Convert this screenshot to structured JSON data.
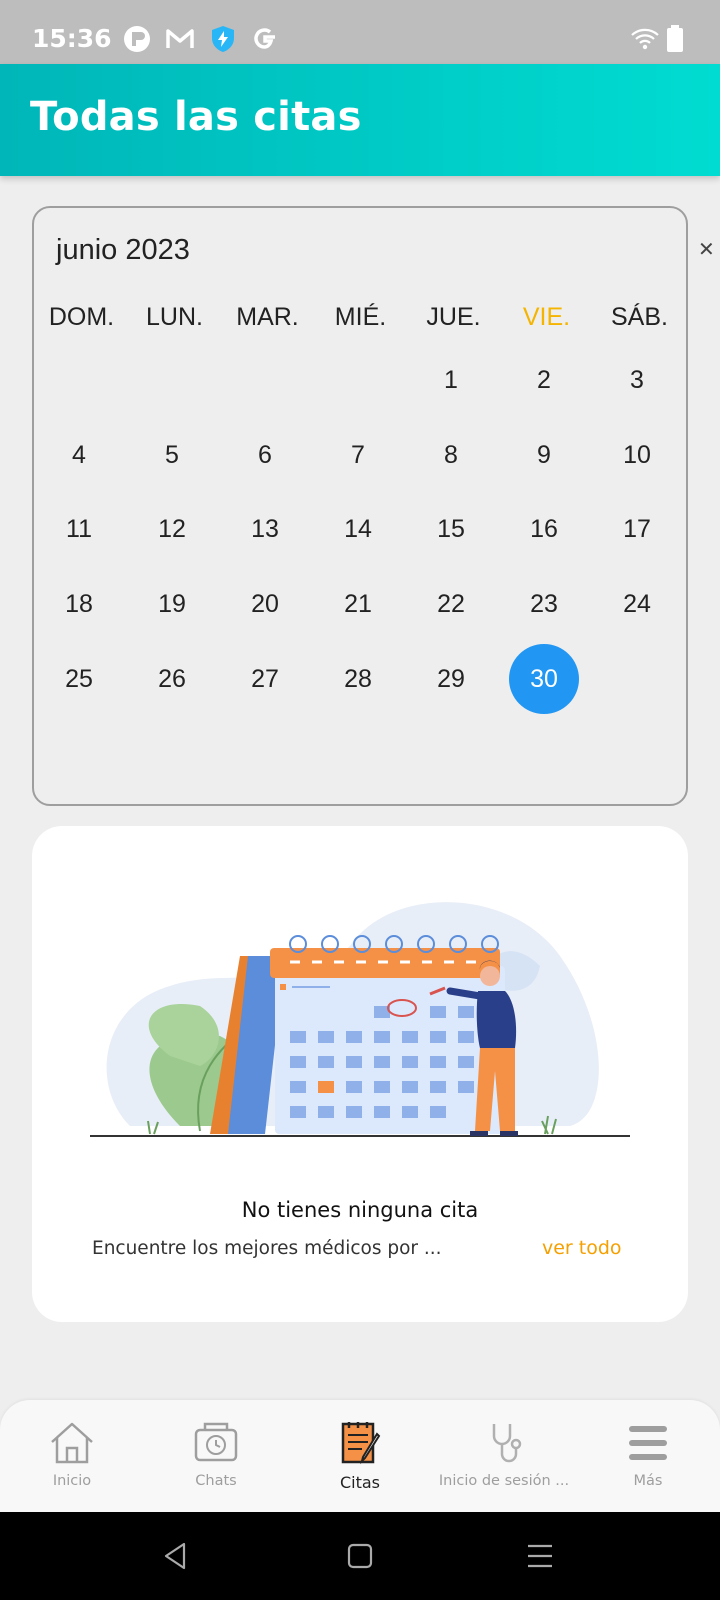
{
  "status_bar": {
    "time": "15:36",
    "left_icons": [
      "r-app-icon",
      "gmail-icon",
      "bolt-shield-icon",
      "google-icon"
    ],
    "right_icons": [
      "wifi-icon",
      "battery-icon"
    ]
  },
  "app_bar": {
    "title": "Todas las citas"
  },
  "calendar": {
    "month_label": "junio 2023",
    "weekdays": [
      "DOM.",
      "LUN.",
      "MAR.",
      "MIÉ.",
      "JUE.",
      "VIE.",
      "SÁB."
    ],
    "highlighted_weekday": "VIE.",
    "weeks": [
      [
        "",
        "",
        "",
        "",
        "1",
        "2",
        "3"
      ],
      [
        "4",
        "5",
        "6",
        "7",
        "8",
        "9",
        "10"
      ],
      [
        "11",
        "12",
        "13",
        "14",
        "15",
        "16",
        "17"
      ],
      [
        "18",
        "19",
        "20",
        "21",
        "22",
        "23",
        "24"
      ],
      [
        "25",
        "26",
        "27",
        "28",
        "29",
        "30",
        ""
      ]
    ],
    "selected_day": "30",
    "accent_color": "#2196f3",
    "weekday_highlight_color": "#f5b400"
  },
  "empty_state": {
    "title": "No tienes ninguna cita",
    "subtitle": "Encuentre los mejores médicos por ...",
    "link_label": "ver todo"
  },
  "bottom_nav": {
    "items": [
      {
        "label": "Inicio",
        "icon": "home-icon",
        "active": false
      },
      {
        "label": "Chats",
        "icon": "chat-history-icon",
        "active": false
      },
      {
        "label": "Citas",
        "icon": "appointments-notepad-icon",
        "active": true
      },
      {
        "label": "Inicio de sesión ...",
        "icon": "stethoscope-icon",
        "active": false
      },
      {
        "label": "Más",
        "icon": "menu-icon",
        "active": false
      }
    ]
  },
  "system_nav": {
    "buttons": [
      "back-icon",
      "home-square-icon",
      "recents-menu-icon"
    ]
  },
  "colors": {
    "app_bar_start": "#00b6b8",
    "app_bar_end": "#00dcd1",
    "link": "#f5a000"
  }
}
